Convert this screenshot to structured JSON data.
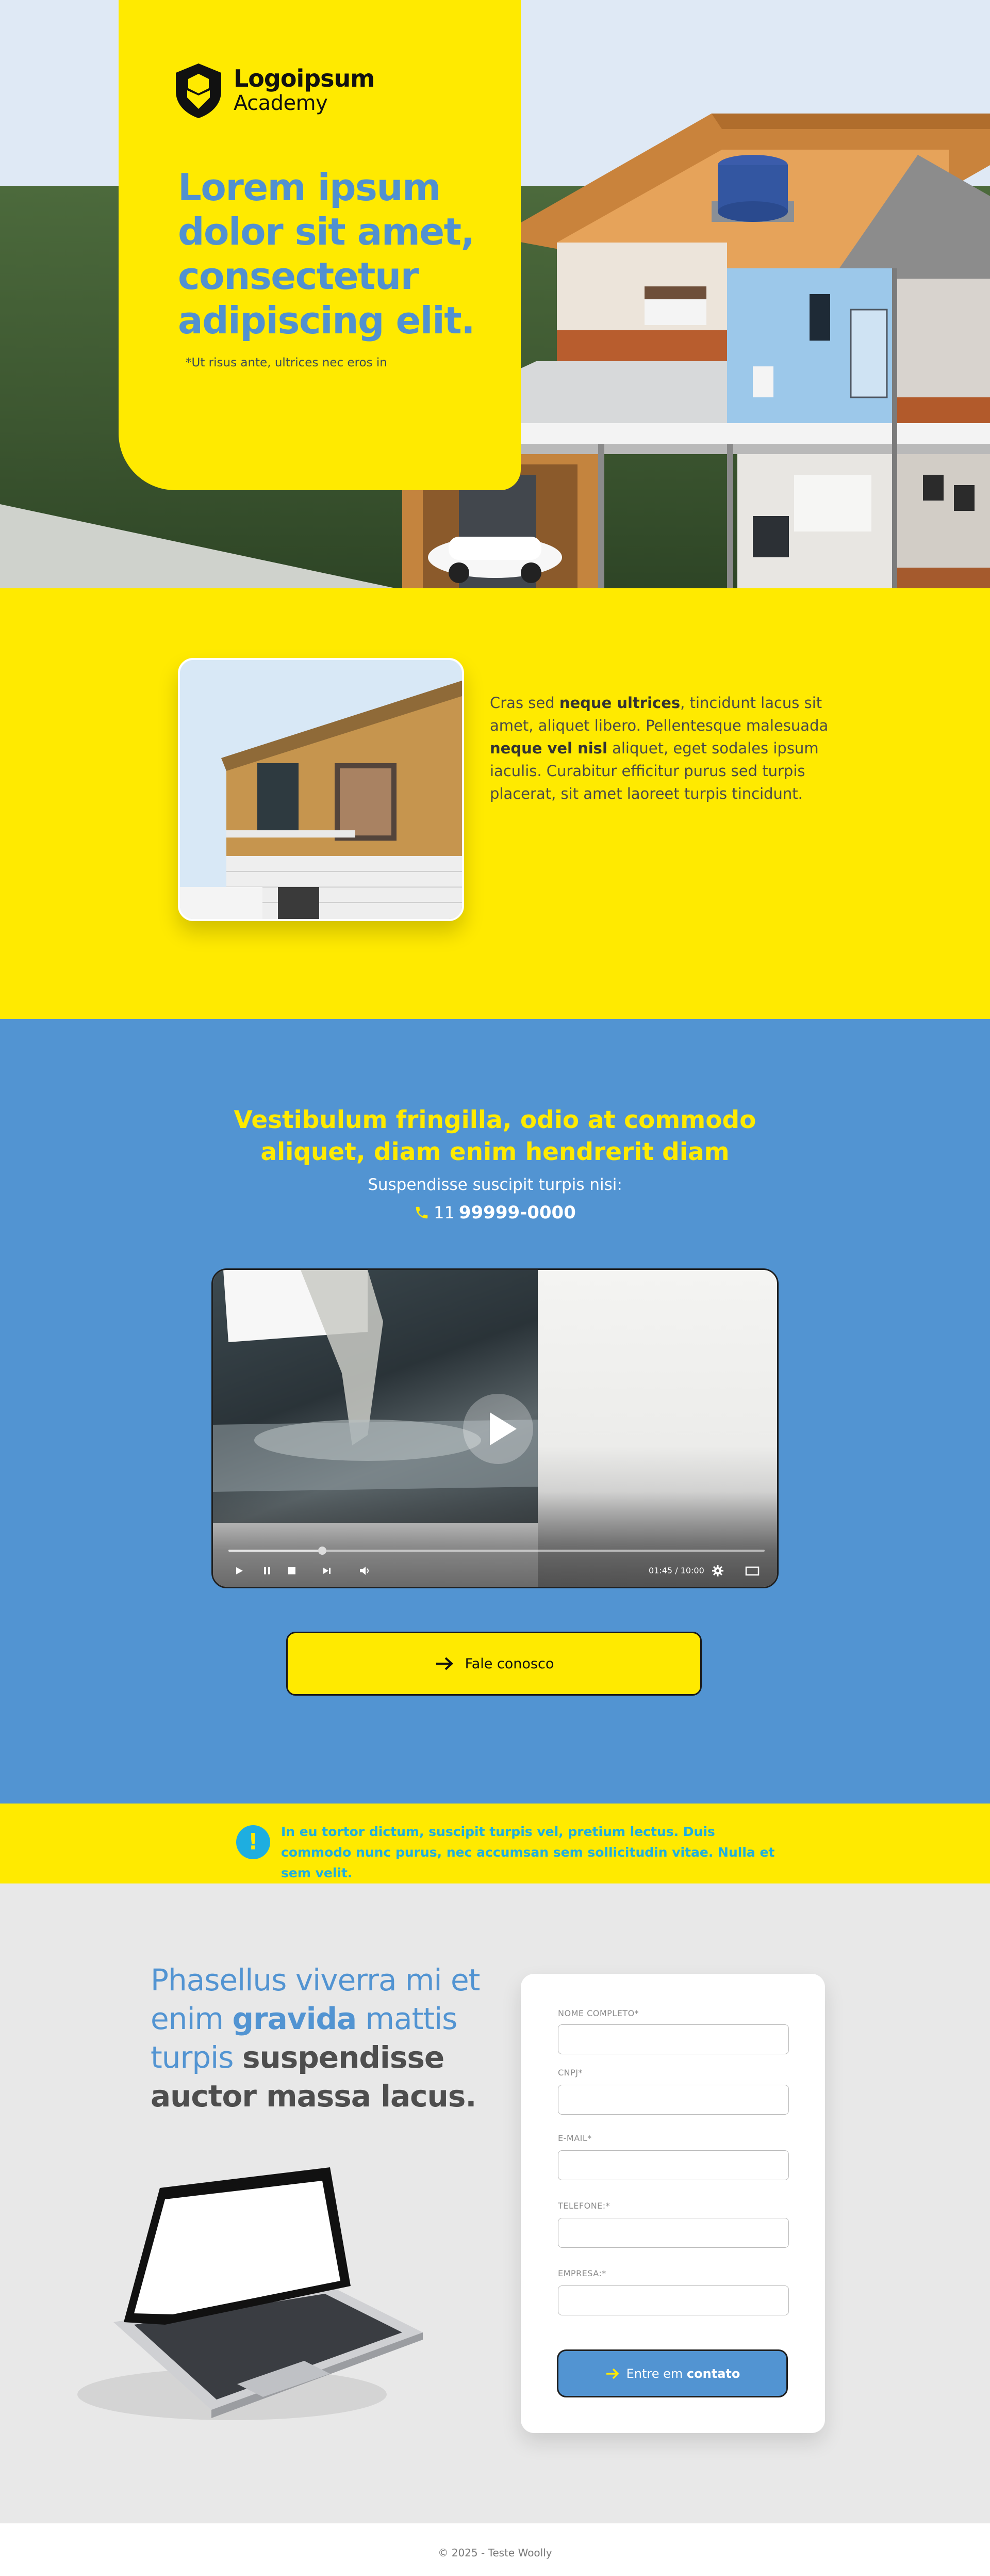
{
  "brand": {
    "name": "Logoipsum",
    "sub": "Academy",
    "colors": {
      "yellow": "#ffea00",
      "blue": "#5294d2",
      "cyan": "#1eaee0",
      "light_gray": "#e8e8e8"
    }
  },
  "hero": {
    "title": "Lorem ipsum dolor sit amet, consectetur adipiscing elit.",
    "note": "*Ut risus ante, ultrices nec eros in",
    "image": "house-cutaway-illustration"
  },
  "intro": {
    "image": "house-photo",
    "text_parts": [
      {
        "t": "Cras sed ",
        "bold": false
      },
      {
        "t": "neque ultrices",
        "bold": true
      },
      {
        "t": ", tincidunt lacus sit amet, aliquet libero. Pellentesque malesuada ",
        "bold": false
      },
      {
        "t": "neque vel nisl",
        "bold": true
      },
      {
        "t": " aliquet, eget sodales ipsum iaculis. Curabitur efficitur purus sed turpis placerat, sit amet laoreet turpis tincidunt.",
        "bold": false
      }
    ]
  },
  "contact_block": {
    "title": "Vestibulum fringilla, odio at commodo aliquet, diam enim hendrerit diam",
    "subtitle": "Suspendisse suscipit turpis nisi:",
    "phone_ddd": "11",
    "phone_number": "99999-0000",
    "phone_icon": "phone-icon"
  },
  "video": {
    "time": "01:45 / 10:00",
    "progress": 0.175,
    "play_icon": "play-icon",
    "controls": [
      "play-icon",
      "pause-icon",
      "stop-icon",
      "next-icon",
      "volume-icon",
      "settings-icon",
      "fullscreen-icon"
    ]
  },
  "cta": {
    "label": "Fale conosco",
    "icon": "arrow-right-icon"
  },
  "notice": {
    "icon": "exclamation-icon",
    "text": "In eu tortor dictum, suscipit turpis vel, pretium lectus. Duis commodo nunc purus, nec accumsan sem sollicitudin vitae. Nulla et sem velit."
  },
  "form_section": {
    "heading": {
      "p1": "Phasellus viverra mi et enim ",
      "p2": "gravida",
      "p3": " mattis turpis ",
      "p4": "suspendisse auctor massa lacus."
    },
    "image": "laptop-illustration",
    "fields": [
      {
        "label": "NOME COMPLETO*",
        "value": ""
      },
      {
        "label": "CNPJ*",
        "value": ""
      },
      {
        "label": "E-MAIL*",
        "value": ""
      },
      {
        "label": "TELEFONE:*",
        "value": ""
      },
      {
        "label": "EMPRESA:*",
        "value": ""
      }
    ],
    "submit": {
      "label_pre": "Entre em ",
      "label_bold": "contato",
      "icon": "arrow-right-icon"
    }
  },
  "footer": {
    "text": "© 2025 - Teste Woolly"
  }
}
